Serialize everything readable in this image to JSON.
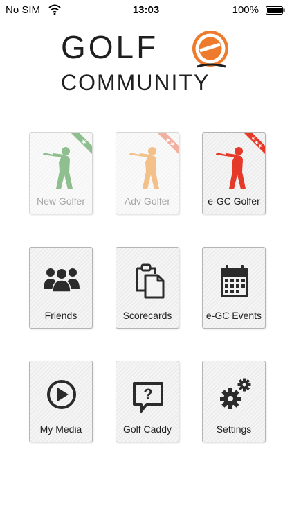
{
  "status_bar": {
    "carrier": "No SIM",
    "time": "13:03",
    "battery_percent": "100%"
  },
  "logo": {
    "line1": "GOLF",
    "line2": "COMMUNITY",
    "badge_letter": "e"
  },
  "tiles": [
    {
      "label": "New Golfer",
      "icon": "golfer-icon",
      "stars": "★",
      "color": "#8fbf8f",
      "ribbon_color": "#8fbf8f"
    },
    {
      "label": "Adv Golfer",
      "icon": "golfer-icon",
      "stars": "★★",
      "color": "#f3c08a",
      "ribbon_color": "#f1b0a0"
    },
    {
      "label": "e-GC Golfer",
      "icon": "golfer-icon",
      "stars": "★★★",
      "color": "#e53a2a",
      "ribbon_color": "#e53a2a"
    },
    {
      "label": "Friends",
      "icon": "group-icon"
    },
    {
      "label": "Scorecards",
      "icon": "clipboard-icon"
    },
    {
      "label": "e-GC Events",
      "icon": "calendar-icon"
    },
    {
      "label": "My Media",
      "icon": "play-icon"
    },
    {
      "label": "Golf Caddy",
      "icon": "help-bubble-icon",
      "glyph": "?"
    },
    {
      "label": "Settings",
      "icon": "gears-icon"
    }
  ],
  "colors": {
    "logo_orange": "#ee7a2c",
    "logo_text": "#1f1f1f",
    "icon_dark": "#2b2b2b"
  }
}
